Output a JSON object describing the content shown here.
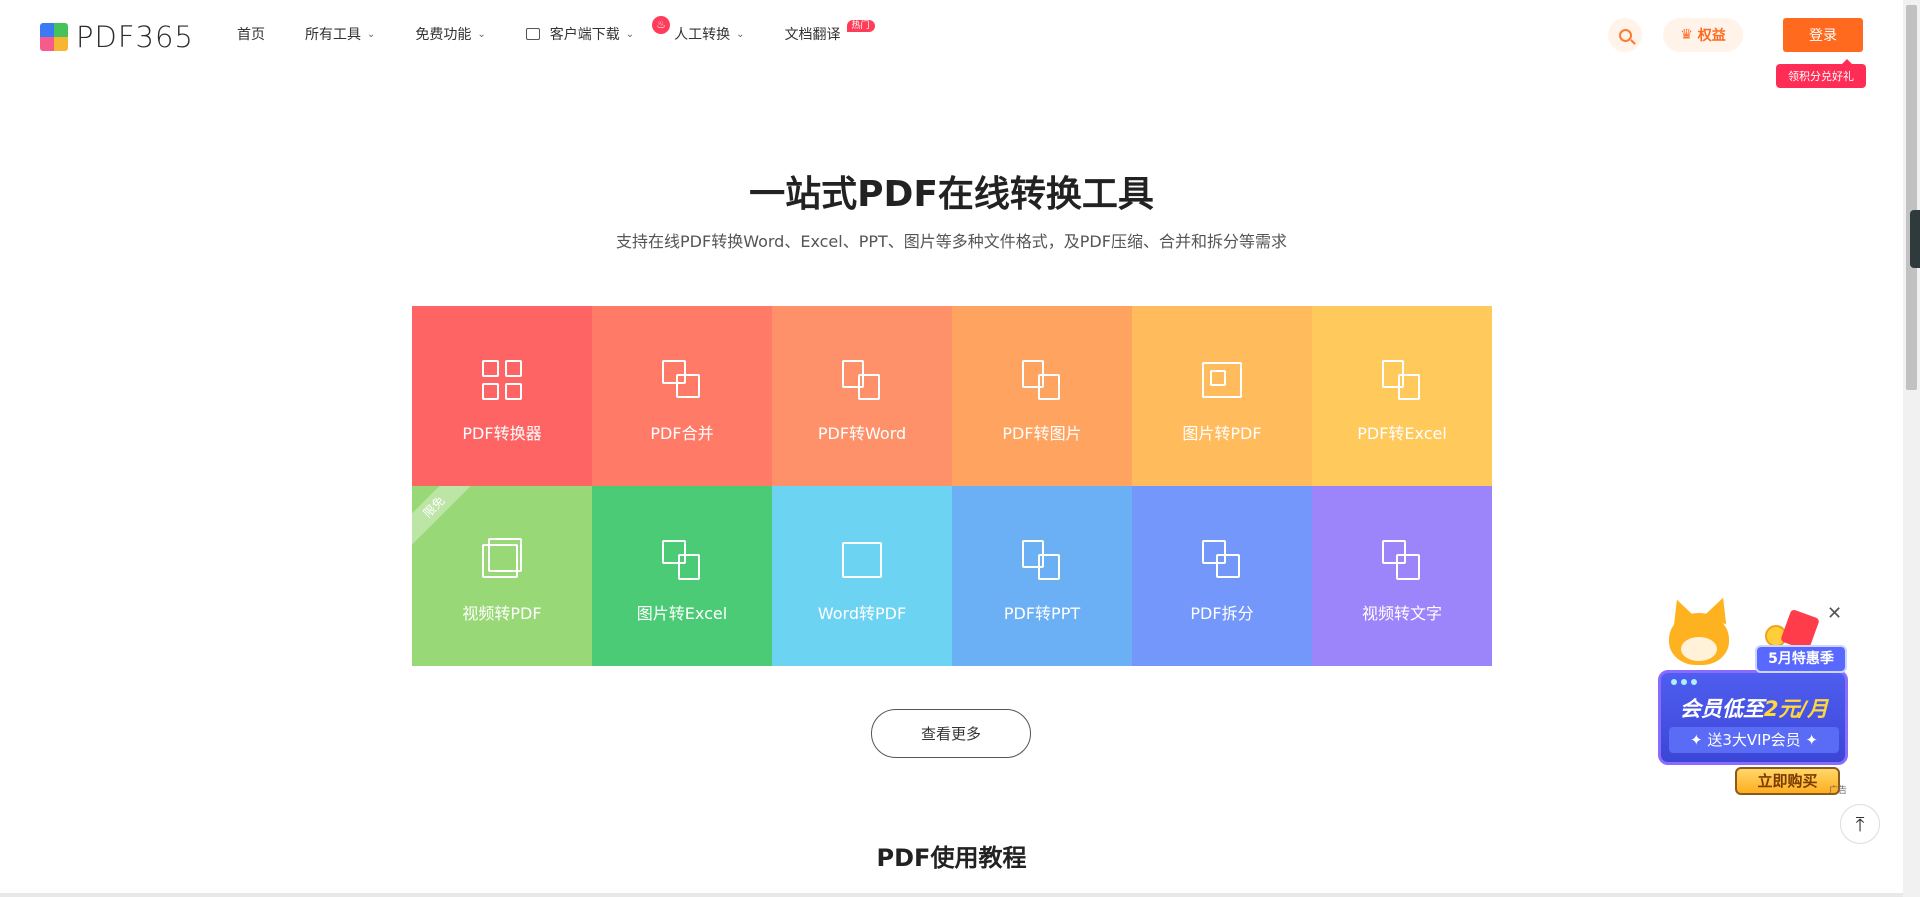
{
  "header": {
    "logo_text": "PDF365",
    "nav": [
      {
        "label": "首页",
        "has_chevron": false
      },
      {
        "label": "所有工具",
        "has_chevron": true
      },
      {
        "label": "免费功能",
        "has_chevron": true
      },
      {
        "label": "客户端下载",
        "has_chevron": true
      },
      {
        "label": "人工转换",
        "has_chevron": true
      },
      {
        "label": "文档翻译",
        "has_chevron": false,
        "badge": "热门"
      }
    ],
    "rights_label": "权益",
    "login_label": "登录",
    "login_tip": "领积分兑好礼"
  },
  "hero": {
    "title": "一站式PDF在线转换工具",
    "subtitle": "支持在线PDF转换Word、Excel、PPT、图片等多种文件格式，及PDF压缩、合并和拆分等需求"
  },
  "tools": [
    {
      "label": "PDF转换器",
      "color": "#ff6464",
      "icon": "grid-icon"
    },
    {
      "label": "PDF合并",
      "color": "#ff7b68",
      "icon": "merge-icon"
    },
    {
      "label": "PDF转Word",
      "color": "#ff916a",
      "icon": "pdf-to-word-icon"
    },
    {
      "label": "PDF转图片",
      "color": "#ffa460",
      "icon": "pdf-to-image-icon"
    },
    {
      "label": "图片转PDF",
      "color": "#ffbb5c",
      "icon": "image-to-pdf-icon"
    },
    {
      "label": "PDF转Excel",
      "color": "#ffc95c",
      "icon": "pdf-to-excel-icon"
    },
    {
      "label": "视频转PDF",
      "color": "#99d877",
      "icon": "video-to-pdf-icon",
      "ribbon": "限免"
    },
    {
      "label": "图片转Excel",
      "color": "#4ccb76",
      "icon": "image-to-excel-icon"
    },
    {
      "label": "Word转PDF",
      "color": "#6dd3f3",
      "icon": "word-to-pdf-icon"
    },
    {
      "label": "PDF转PPT",
      "color": "#6bb0f5",
      "icon": "pdf-to-ppt-icon"
    },
    {
      "label": "PDF拆分",
      "color": "#7497fb",
      "icon": "split-icon"
    },
    {
      "label": "视频转文字",
      "color": "#9c85fa",
      "icon": "video-to-text-icon"
    }
  ],
  "more_label": "查看更多",
  "section_title": "PDF使用教程",
  "ad": {
    "tag": "5月特惠季",
    "main_prefix": "会员低至",
    "main_highlight": "2元/月",
    "sub": "✦ 送3大VIP会员 ✦",
    "buy": "立即购买",
    "ad_label": "广告"
  }
}
